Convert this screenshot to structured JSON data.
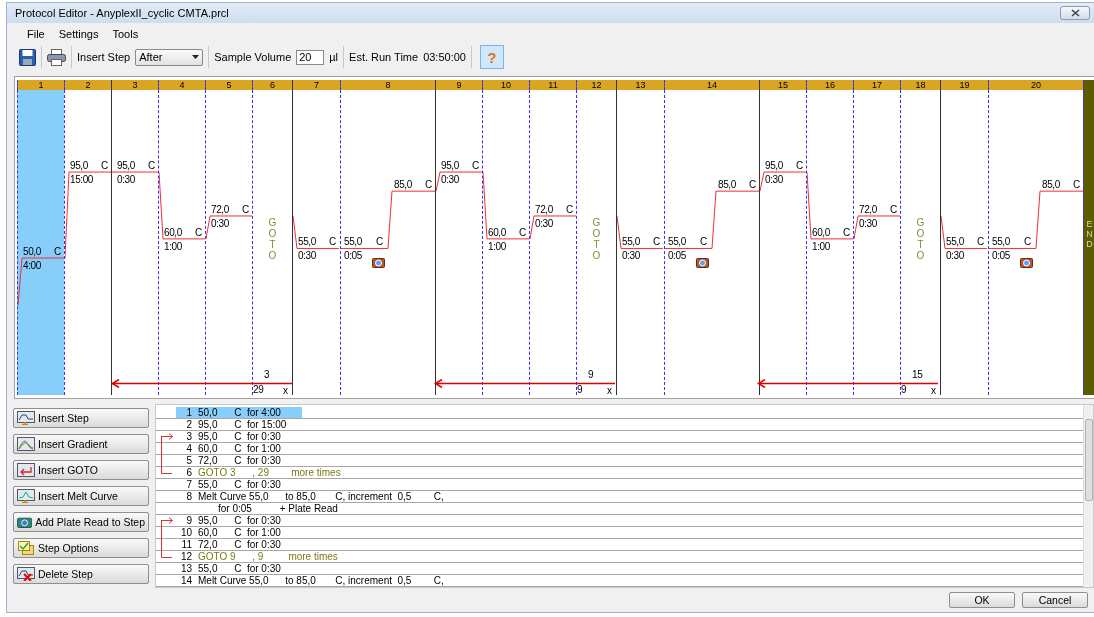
{
  "window": {
    "title": "Protocol Editor - AnyplexII_cyclic CMTA.prcl"
  },
  "menu": [
    "File",
    "Settings",
    "Tools"
  ],
  "toolbar": {
    "insert_step_label": "Insert Step",
    "insert_step_value": "After",
    "sample_volume_label": "Sample Volume",
    "sample_volume_value": "20",
    "sample_volume_unit": "µl",
    "run_time_label": "Est. Run Time",
    "run_time_value": "03:50:00",
    "help": "?"
  },
  "steps": [
    {
      "number": "1",
      "kind": "temp",
      "temperature": "50,0",
      "unit": "C",
      "time": "4:00",
      "selected": true,
      "loop_start": false
    },
    {
      "number": "2",
      "kind": "temp",
      "temperature": "95,0",
      "unit": "C",
      "time": "15:00",
      "selected": false,
      "loop_start": false
    },
    {
      "number": "3",
      "kind": "temp",
      "temperature": "95,0",
      "unit": "C",
      "time": "0:30",
      "selected": false,
      "loop_start": true
    },
    {
      "number": "4",
      "kind": "temp",
      "temperature": "60,0",
      "unit": "C",
      "time": "1:00",
      "selected": false,
      "loop_start": false
    },
    {
      "number": "5",
      "kind": "temp",
      "temperature": "72,0",
      "unit": "C",
      "time": "0:30",
      "selected": false,
      "loop_start": false
    },
    {
      "number": "6",
      "kind": "goto",
      "label": "GOTO",
      "target": "3",
      "repeat": "29",
      "times": "x",
      "selected": false,
      "loop_start": false
    },
    {
      "number": "7",
      "kind": "temp",
      "temperature": "55,0",
      "unit": "C",
      "time": "0:30",
      "selected": false,
      "loop_start": false
    },
    {
      "number": "8",
      "kind": "melt",
      "start": {
        "temperature": "55,0",
        "unit": "C",
        "time": "0:05"
      },
      "end": {
        "temperature": "85,0",
        "unit": "C"
      },
      "plate_read": true,
      "selected": false,
      "loop_start": false
    },
    {
      "number": "9",
      "kind": "temp",
      "temperature": "95,0",
      "unit": "C",
      "time": "0:30",
      "selected": false,
      "loop_start": true
    },
    {
      "number": "10",
      "kind": "temp",
      "temperature": "60,0",
      "unit": "C",
      "time": "1:00",
      "selected": false,
      "loop_start": false
    },
    {
      "number": "11",
      "kind": "temp",
      "temperature": "72,0",
      "unit": "C",
      "time": "0:30",
      "selected": false,
      "loop_start": false
    },
    {
      "number": "12",
      "kind": "goto",
      "label": "GOTO",
      "target": "9",
      "repeat": "9",
      "times": "x",
      "selected": false,
      "loop_start": false
    },
    {
      "number": "13",
      "kind": "temp",
      "temperature": "55,0",
      "unit": "C",
      "time": "0:30",
      "selected": false,
      "loop_start": false
    },
    {
      "number": "14",
      "kind": "melt",
      "start": {
        "temperature": "55,0",
        "unit": "C",
        "time": "0:05"
      },
      "end": {
        "temperature": "85,0",
        "unit": "C"
      },
      "plate_read": true,
      "selected": false,
      "loop_start": false
    },
    {
      "number": "15",
      "kind": "temp",
      "temperature": "95,0",
      "unit": "C",
      "time": "0:30",
      "selected": false,
      "loop_start": true
    },
    {
      "number": "16",
      "kind": "temp",
      "temperature": "60,0",
      "unit": "C",
      "time": "1:00",
      "selected": false,
      "loop_start": false
    },
    {
      "number": "17",
      "kind": "temp",
      "temperature": "72,0",
      "unit": "C",
      "time": "0:30",
      "selected": false,
      "loop_start": false
    },
    {
      "number": "18",
      "kind": "goto",
      "label": "GOTO",
      "target": "15",
      "repeat": "9",
      "times": "x",
      "selected": false,
      "loop_start": false
    },
    {
      "number": "19",
      "kind": "temp",
      "temperature": "55,0",
      "unit": "C",
      "time": "0:30",
      "selected": false,
      "loop_start": false
    },
    {
      "number": "20",
      "kind": "melt",
      "start": {
        "temperature": "55,0",
        "unit": "C",
        "time": "0:05"
      },
      "end": {
        "temperature": "85,0",
        "unit": "C"
      },
      "plate_read": true,
      "selected": false,
      "loop_start": false
    }
  ],
  "end_label": "END",
  "actions": [
    "Insert Step",
    "Insert Gradient",
    "Insert GOTO",
    "Insert Melt Curve",
    "Add Plate Read to Step",
    "Step Options",
    "Delete Step"
  ],
  "step_list": [
    {
      "number": "1",
      "kind": "step",
      "text": "50,0      C  for 4:00",
      "selected": true,
      "loop_start": false
    },
    {
      "number": "2",
      "kind": "step",
      "text": "95,0      C  for 15:00",
      "selected": false,
      "loop_start": false
    },
    {
      "number": "3",
      "kind": "step",
      "text": "95,0      C  for 0:30",
      "selected": false,
      "loop_start": true
    },
    {
      "number": "4",
      "kind": "step",
      "text": "60,0      C  for 1:00",
      "selected": false,
      "loop_start": false
    },
    {
      "number": "5",
      "kind": "step",
      "text": "72,0      C  for 0:30",
      "selected": false,
      "loop_start": false
    },
    {
      "number": "6",
      "kind": "goto",
      "text": "GOTO 3      , 29        more times",
      "selected": false,
      "loop_start": false
    },
    {
      "number": "7",
      "kind": "step",
      "text": "55,0      C  for 0:30",
      "selected": false,
      "loop_start": false
    },
    {
      "number": "8",
      "kind": "melt",
      "text": "Melt Curve 55,0      to 85,0       C, increment  0,5        C,",
      "continuation": "for 0:05          + Plate Read",
      "selected": false,
      "loop_start": false
    },
    {
      "number": "9",
      "kind": "step",
      "text": "95,0      C  for 0:30",
      "selected": false,
      "loop_start": true
    },
    {
      "number": "10",
      "kind": "step",
      "text": "60,0      C  for 1:00",
      "selected": false,
      "loop_start": false
    },
    {
      "number": "11",
      "kind": "step",
      "text": "72,0      C  for 0:30",
      "selected": false,
      "loop_start": false
    },
    {
      "number": "12",
      "kind": "goto",
      "text": "GOTO 9      , 9         more times",
      "selected": false,
      "loop_start": false
    },
    {
      "number": "13",
      "kind": "step",
      "text": "55,0      C  for 0:30",
      "selected": false,
      "loop_start": false
    },
    {
      "number": "14",
      "kind": "melt",
      "text": "Melt Curve 55,0      to 85,0       C, increment  0,5        C,",
      "selected": false,
      "loop_start": false
    }
  ],
  "footer_buttons": [
    "OK",
    "Cancel"
  ]
}
